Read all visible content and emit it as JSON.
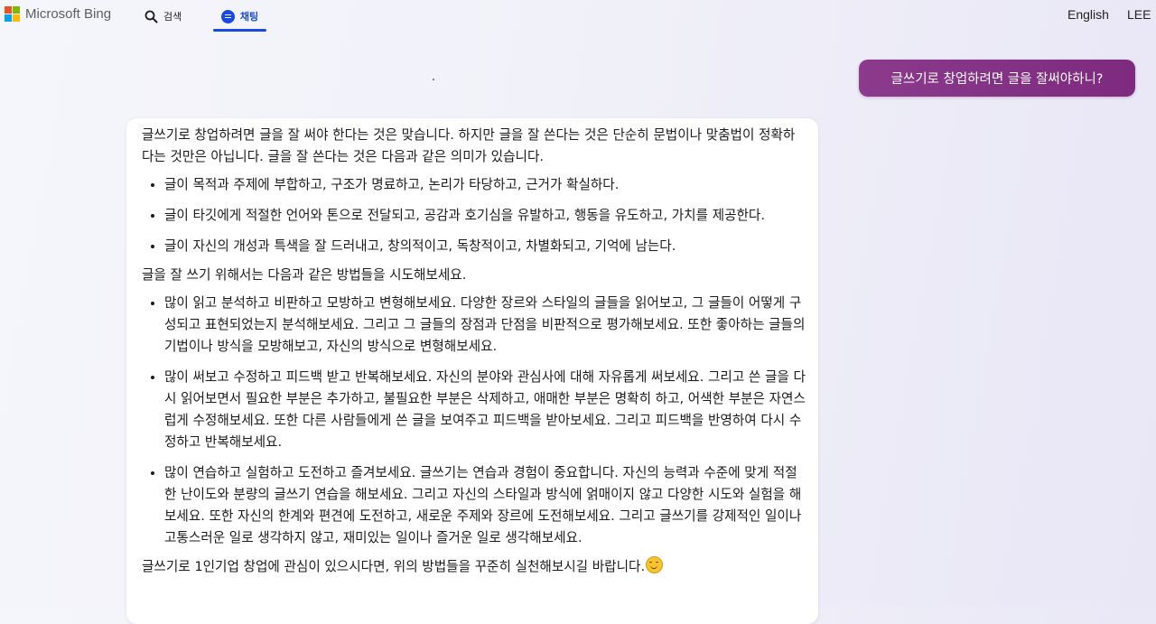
{
  "header": {
    "brand": "Microsoft Bing",
    "logo_colors": [
      "#f25022",
      "#7fba00",
      "#00a4ef",
      "#ffb900"
    ],
    "tabs": [
      {
        "label": "검색",
        "icon": "search-icon",
        "active": false
      },
      {
        "label": "채팅",
        "icon": "chat-icon",
        "active": true
      }
    ],
    "language": "English",
    "user": "LEE",
    "accent": "#174ae4"
  },
  "conversation": {
    "user_message": "글쓰기로 창업하려면 글을 잘써야하니?",
    "user_bubble_color": "#8b3a8c",
    "bot": {
      "intro": "글쓰기로 창업하려면 글을 잘 써야 한다는 것은 맞습니다. 하지만 글을 잘 쓴다는 것은 단순히 문법이나 맞춤법이 정확하다는 것만은 아닙니다. 글을 잘 쓴다는 것은 다음과 같은 의미가 있습니다.",
      "meanings": [
        "글이 목적과 주제에 부합하고, 구조가 명료하고, 논리가 타당하고, 근거가 확실하다.",
        "글이 타깃에게 적절한 언어와 톤으로 전달되고, 공감과 호기심을 유발하고, 행동을 유도하고, 가치를 제공한다.",
        "글이 자신의 개성과 특색을 잘 드러내고, 창의적이고, 독창적이고, 차별화되고, 기억에 남는다."
      ],
      "methods_intro": "글을 잘 쓰기 위해서는 다음과 같은 방법들을 시도해보세요.",
      "methods": [
        "많이 읽고 분석하고 비판하고 모방하고 변형해보세요. 다양한 장르와 스타일의 글들을 읽어보고, 그 글들이 어떻게 구성되고 표현되었는지 분석해보세요. 그리고 그 글들의 장점과 단점을 비판적으로 평가해보세요. 또한 좋아하는 글들의 기법이나 방식을 모방해보고, 자신의 방식으로 변형해보세요.",
        "많이 써보고 수정하고 피드백 받고 반복해보세요. 자신의 분야와 관심사에 대해 자유롭게 써보세요. 그리고 쓴 글을 다시 읽어보면서 필요한 부분은 추가하고, 불필요한 부분은 삭제하고, 애매한 부분은 명확히 하고, 어색한 부분은 자연스럽게 수정해보세요. 또한 다른 사람들에게 쓴 글을 보여주고 피드백을 받아보세요. 그리고 피드백을 반영하여 다시 수정하고 반복해보세요.",
        "많이 연습하고 실험하고 도전하고 즐겨보세요. 글쓰기는 연습과 경험이 중요합니다. 자신의 능력과 수준에 맞게 적절한 난이도와 분량의 글쓰기 연습을 해보세요. 그리고 자신의 스타일과 방식에 얽매이지 않고 다양한 시도와 실험을 해보세요. 또한 자신의 한계와 편견에 도전하고, 새로운 주제와 장르에 도전해보세요. 그리고 글쓰기를 강제적인 일이나 고통스러운 일로 생각하지 않고, 재미있는 일이나 즐거운 일로 생각해보세요."
      ],
      "closing": "글쓰기로 1인기업 창업에 관심이 있으시다면, 위의 방법들을 꾸준히 실천해보시길 바랍니다.",
      "closing_emoji": "smiling-face-icon"
    }
  }
}
